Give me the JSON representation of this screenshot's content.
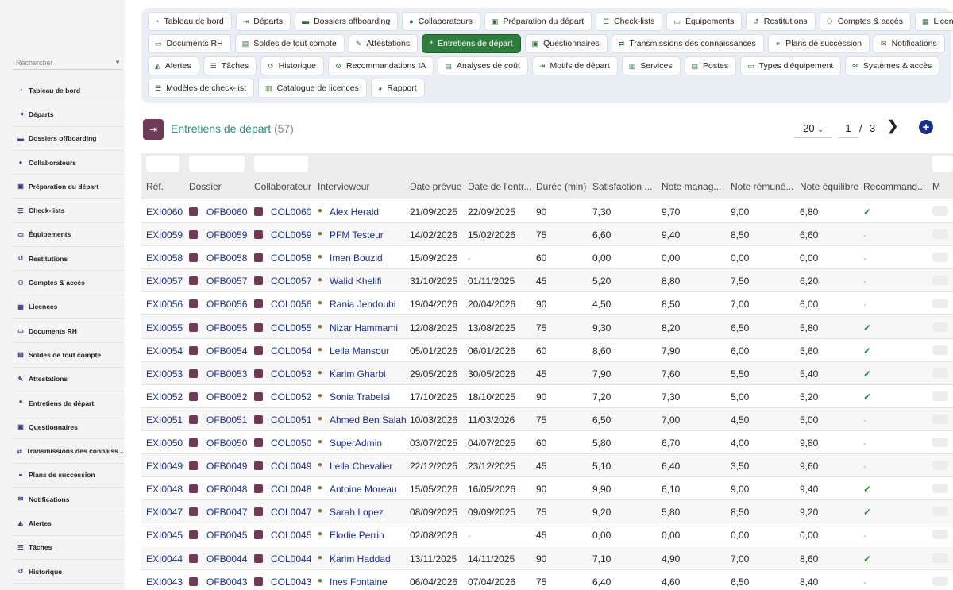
{
  "sidebar": {
    "search_placeholder": "Rechercher",
    "items": [
      {
        "label": "Tableau de bord",
        "icon": "dashboard-icon"
      },
      {
        "label": "Départs",
        "icon": "exit-icon"
      },
      {
        "label": "Dossiers offboarding",
        "icon": "folder-icon"
      },
      {
        "label": "Collaborateurs",
        "icon": "user-icon"
      },
      {
        "label": "Préparation du départ",
        "icon": "clipboard-icon"
      },
      {
        "label": "Check-lists",
        "icon": "list-icon"
      },
      {
        "label": "Équipements",
        "icon": "laptop-icon"
      },
      {
        "label": "Restitutions",
        "icon": "undo-icon"
      },
      {
        "label": "Comptes & accès",
        "icon": "users-icon"
      },
      {
        "label": "Licences",
        "icon": "license-icon"
      },
      {
        "label": "Documents RH",
        "icon": "folder-open-icon"
      },
      {
        "label": "Soldes de tout compte",
        "icon": "money-icon"
      },
      {
        "label": "Attestations",
        "icon": "certificate-icon"
      },
      {
        "label": "Entretiens de départ",
        "icon": "comments-icon"
      },
      {
        "label": "Questionnaires",
        "icon": "form-icon"
      },
      {
        "label": "Transmissions des connaiss...",
        "icon": "exchange-icon"
      },
      {
        "label": "Plans de succession",
        "icon": "sitemap-icon"
      },
      {
        "label": "Notifications",
        "icon": "envelope-icon"
      },
      {
        "label": "Alertes",
        "icon": "bell-icon"
      },
      {
        "label": "Tâches",
        "icon": "tasks-icon"
      },
      {
        "label": "Historique",
        "icon": "history-icon"
      }
    ]
  },
  "nav": {
    "rows": [
      [
        {
          "label": "Tableau de bord",
          "icon": "dashboard-icon"
        },
        {
          "label": "Départs",
          "icon": "exit-icon"
        },
        {
          "label": "Dossiers offboarding",
          "icon": "folder-icon"
        },
        {
          "label": "Collaborateurs",
          "icon": "user-icon"
        },
        {
          "label": "Préparation du départ",
          "icon": "clipboard-icon"
        },
        {
          "label": "Check-lists",
          "icon": "list-icon"
        },
        {
          "label": "Équipements",
          "icon": "laptop-icon"
        },
        {
          "label": "Restitutions",
          "icon": "undo-icon"
        },
        {
          "label": "Comptes & accès",
          "icon": "users-icon"
        },
        {
          "label": "Licences",
          "icon": "license-icon"
        }
      ],
      [
        {
          "label": "Documents RH",
          "icon": "folder-open-icon"
        },
        {
          "label": "Soldes de tout compte",
          "icon": "money-icon"
        },
        {
          "label": "Attestations",
          "icon": "certificate-icon"
        },
        {
          "label": "Entretiens de départ",
          "icon": "comments-icon",
          "active": true
        },
        {
          "label": "Questionnaires",
          "icon": "form-icon"
        },
        {
          "label": "Transmissions des connaissances",
          "icon": "exchange-icon"
        },
        {
          "label": "Plans de succession",
          "icon": "sitemap-icon"
        },
        {
          "label": "Notifications",
          "icon": "envelope-icon"
        }
      ],
      [
        {
          "label": "Alertes",
          "icon": "bell-icon"
        },
        {
          "label": "Tâches",
          "icon": "tasks-icon"
        },
        {
          "label": "Historique",
          "icon": "history-icon"
        },
        {
          "label": "Recommandations IA",
          "icon": "robot-icon"
        },
        {
          "label": "Analyses de coût",
          "icon": "money-icon"
        },
        {
          "label": "Motifs de départ",
          "icon": "exit-icon"
        },
        {
          "label": "Services",
          "icon": "building-icon"
        },
        {
          "label": "Postes",
          "icon": "badge-icon"
        },
        {
          "label": "Types d'équipement",
          "icon": "laptop-icon"
        },
        {
          "label": "Systèmes & accès",
          "icon": "network-icon"
        }
      ],
      [
        {
          "label": "Modèles de check-list",
          "icon": "list-icon"
        },
        {
          "label": "Catalogue de licences",
          "icon": "book-icon"
        },
        {
          "label": "Rapport",
          "icon": "pie-icon"
        }
      ]
    ]
  },
  "page": {
    "title": "Entretiens de départ",
    "count": "(57)",
    "page_size": "20",
    "page_no": "1",
    "slash": "/",
    "page_total": "3",
    "next": "❯",
    "add": "+"
  },
  "table": {
    "headers": [
      "Réf.",
      "Dossier",
      "Collaborateur",
      "Intervieweur",
      "Date prévue",
      "Date de l'entr...",
      "Durée (min)",
      "Satisfaction ...",
      "Note manag...",
      "Note rémuné...",
      "Note équilibre",
      "Recommand...",
      "M"
    ],
    "rows": [
      [
        "EXI0060",
        "OFB0060",
        "COL0060",
        "Alex Herald",
        "21/09/2025",
        "22/09/2025",
        "90",
        "7,30",
        "9,70",
        "9,00",
        "6,80",
        "yes"
      ],
      [
        "EXI0059",
        "OFB0059",
        "COL0059",
        "PFM Testeur",
        "14/02/2026",
        "15/02/2026",
        "75",
        "6,60",
        "9,40",
        "8,50",
        "6,60",
        "no"
      ],
      [
        "EXI0058",
        "OFB0058",
        "COL0058",
        "Imen Bouzid",
        "15/09/2026",
        "-",
        "60",
        "0,00",
        "0,00",
        "0,00",
        "0,00",
        "no"
      ],
      [
        "EXI0057",
        "OFB0057",
        "COL0057",
        "Walid Khelifi",
        "31/10/2025",
        "01/11/2025",
        "45",
        "5,20",
        "8,80",
        "7,50",
        "6,20",
        "no"
      ],
      [
        "EXI0056",
        "OFB0056",
        "COL0056",
        "Rania Jendoubi",
        "19/04/2026",
        "20/04/2026",
        "90",
        "4,50",
        "8,50",
        "7,00",
        "6,00",
        "no"
      ],
      [
        "EXI0055",
        "OFB0055",
        "COL0055",
        "Nizar Hammami",
        "12/08/2025",
        "13/08/2025",
        "75",
        "9,30",
        "8,20",
        "6,50",
        "5,80",
        "yes"
      ],
      [
        "EXI0054",
        "OFB0054",
        "COL0054",
        "Leila Mansour",
        "05/01/2026",
        "06/01/2026",
        "60",
        "8,60",
        "7,90",
        "6,00",
        "5,60",
        "yes"
      ],
      [
        "EXI0053",
        "OFB0053",
        "COL0053",
        "Karim Gharbi",
        "29/05/2026",
        "30/05/2026",
        "45",
        "7,90",
        "7,60",
        "5,50",
        "5,40",
        "yes"
      ],
      [
        "EXI0052",
        "OFB0052",
        "COL0052",
        "Sonia Trabelsi",
        "17/10/2025",
        "18/10/2025",
        "90",
        "7,20",
        "7,30",
        "5,00",
        "5,20",
        "yes"
      ],
      [
        "EXI0051",
        "OFB0051",
        "COL0051",
        "Ahmed Ben Salah",
        "10/03/2026",
        "11/03/2026",
        "75",
        "6,50",
        "7,00",
        "4,50",
        "5,00",
        "no"
      ],
      [
        "EXI0050",
        "OFB0050",
        "COL0050",
        "SuperAdmin",
        "03/07/2025",
        "04/07/2025",
        "60",
        "5,80",
        "6,70",
        "4,00",
        "9,80",
        "no"
      ],
      [
        "EXI0049",
        "OFB0049",
        "COL0049",
        "Leila Chevalier",
        "22/12/2025",
        "23/12/2025",
        "45",
        "5,10",
        "6,40",
        "3,50",
        "9,60",
        "no"
      ],
      [
        "EXI0048",
        "OFB0048",
        "COL0048",
        "Antoine Moreau",
        "15/05/2026",
        "16/05/2026",
        "90",
        "9,90",
        "6,10",
        "9,00",
        "9,40",
        "yes"
      ],
      [
        "EXI0047",
        "OFB0047",
        "COL0047",
        "Sarah Lopez",
        "08/09/2025",
        "09/09/2025",
        "75",
        "9,20",
        "5,80",
        "8,50",
        "9,20",
        "yes"
      ],
      [
        "EXI0045",
        "OFB0045",
        "COL0045",
        "Elodie Perrin",
        "02/08/2026",
        "-",
        "45",
        "0,00",
        "0,00",
        "0,00",
        "0,00",
        "no"
      ],
      [
        "EXI0044",
        "OFB0044",
        "COL0044",
        "Karim Haddad",
        "13/11/2025",
        "14/11/2025",
        "90",
        "7,10",
        "4,90",
        "7,00",
        "8,60",
        "yes"
      ],
      [
        "EXI0043",
        "OFB0043",
        "COL0043",
        "Ines Fontaine",
        "06/04/2026",
        "07/04/2026",
        "75",
        "6,40",
        "4,60",
        "6,50",
        "8,40",
        "no"
      ]
    ]
  },
  "colors": {
    "accent": "#2e7d3f",
    "link": "#1a2f86",
    "title": "#2e8c8c",
    "badge": "#6f3a55"
  }
}
